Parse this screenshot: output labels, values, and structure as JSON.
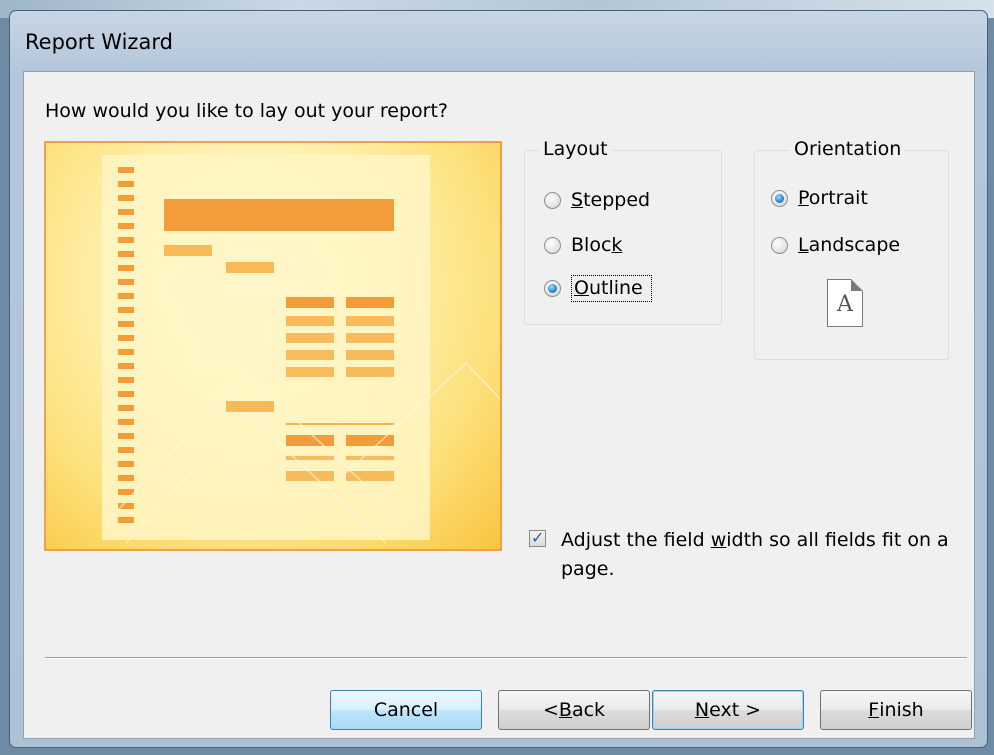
{
  "window": {
    "title": "Report Wizard"
  },
  "wizard": {
    "question": "How would you like to lay out your report?",
    "layout_group": {
      "legend": "Layout",
      "options": [
        {
          "label_pre": "",
          "label_ul": "S",
          "label_post": "tepped",
          "checked": false
        },
        {
          "label_pre": "Bloc",
          "label_ul": "k",
          "label_post": "",
          "checked": false
        },
        {
          "label_pre": "",
          "label_ul": "O",
          "label_post": "utline",
          "checked": true
        }
      ]
    },
    "orientation_group": {
      "legend": "Orientation",
      "options": [
        {
          "label_pre": "",
          "label_ul": "P",
          "label_post": "ortrait",
          "checked": true
        },
        {
          "label_pre": "",
          "label_ul": "L",
          "label_post": "andscape",
          "checked": false
        }
      ],
      "page_letter": "A"
    },
    "adjust_width": {
      "checked": true,
      "label_pre": "Adjust the field ",
      "label_ul": "w",
      "label_post": "idth so all fields fit on a page."
    }
  },
  "buttons": {
    "cancel": {
      "pre": "Cancel",
      "ul": "",
      "post": ""
    },
    "back": {
      "pre": "< ",
      "ul": "B",
      "post": "ack"
    },
    "next": {
      "pre": "",
      "ul": "N",
      "post": "ext >"
    },
    "finish": {
      "pre": "",
      "ul": "F",
      "post": "inish"
    }
  },
  "colors": {
    "preview_border": "#f0a04b",
    "preview_bar": "#f39c3a",
    "focus_blue": "#3c7fb1"
  }
}
